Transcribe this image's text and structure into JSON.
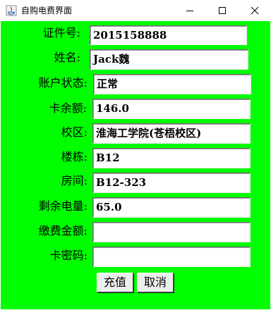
{
  "window": {
    "title": "自购电费界面",
    "controls": {
      "minimize_icon": "minimize-icon",
      "maximize_icon": "maximize-icon",
      "close_icon": "close-icon"
    }
  },
  "colors": {
    "background": "#00ff00",
    "field": "#ffffff"
  },
  "form": {
    "fields": [
      {
        "label": "证件号:",
        "value": "2015158888"
      },
      {
        "label": "姓名:",
        "value": "Jack魏"
      },
      {
        "label": "账户状态:",
        "value": "正常"
      },
      {
        "label": "卡余额:",
        "value": "146.0"
      },
      {
        "label": "校区:",
        "value": "淮海工学院(苍梧校区)"
      },
      {
        "label": "楼栋:",
        "value": "B12"
      },
      {
        "label": "房间:",
        "value": "B12-323"
      },
      {
        "label": "剩余电量:",
        "value": "65.0"
      },
      {
        "label": "缴费金额:",
        "value": ""
      },
      {
        "label": "卡密码:",
        "value": ""
      }
    ],
    "buttons": {
      "recharge": "充值",
      "cancel": "取消"
    }
  }
}
